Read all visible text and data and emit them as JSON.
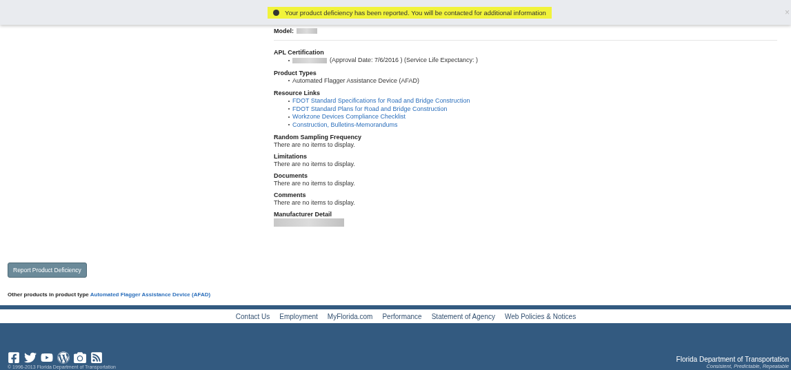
{
  "alert": {
    "message": "Your product deficiency has been reported. You will be contacted for additional information",
    "close": "×"
  },
  "model": {
    "label": "Model:"
  },
  "sections": [
    {
      "kind": "certification",
      "title": "APL Certification",
      "items": [
        "(Approval Date: 7/6/2016 ) (Service Life Expectancy: )"
      ]
    },
    {
      "kind": "list",
      "title": "Product Types",
      "items": [
        "Automated Flagger Assistance Device (AFAD)"
      ]
    },
    {
      "kind": "links",
      "title": "Resource Links",
      "items": [
        "FDOT Standard Specifications for Road and Bridge Construction",
        "FDOT Standard Plans for Road and Bridge Construction",
        "Workzone Devices Compliance Checklist",
        "Construction, Bulletins-Memorandums"
      ]
    },
    {
      "kind": "text",
      "title": "Random Sampling Frequency",
      "text": "There are no items to display."
    },
    {
      "kind": "text",
      "title": "Limitations",
      "text": "There are no items to display."
    },
    {
      "kind": "text",
      "title": "Documents",
      "text": "There are no items to display."
    },
    {
      "kind": "text",
      "title": "Comments",
      "text": "There are no items to display."
    },
    {
      "kind": "redacted",
      "title": "Manufacturer Detail"
    }
  ],
  "report_button": "Report Product Deficiency",
  "other_products": {
    "label": "Other products in product type",
    "link": "Automated Flagger Assistance Device (AFAD)"
  },
  "footer_links": [
    "Contact Us",
    "Employment",
    "MyFlorida.com",
    "Performance",
    "Statement of Agency",
    "Web Policies & Notices"
  ],
  "footer": {
    "copyright": "© 1996-2013 Florida Department of Transportation",
    "agency": "Florida Department of Transportation",
    "tagline": "Consistent, Predictable, Repeatable"
  }
}
